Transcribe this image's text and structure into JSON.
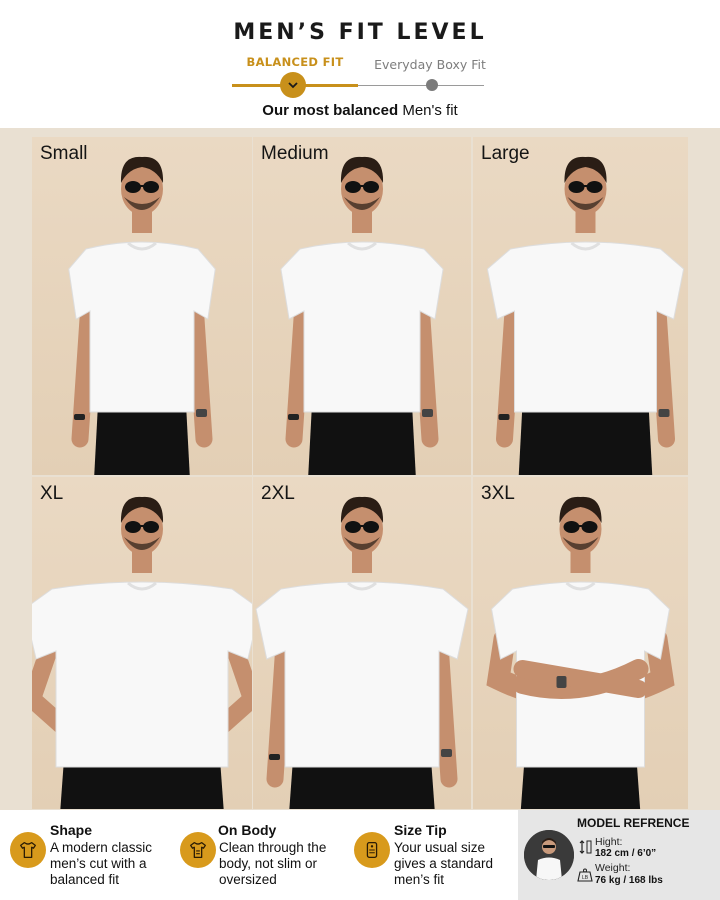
{
  "header": {
    "title": "MEN’S FIT LEVEL",
    "fit_selected": "BALANCED FIT",
    "fit_other": "Everyday Boxy Fit",
    "fit_level": 0.5,
    "subtitle_bold": "Our most balanced",
    "subtitle_rest": "Men's fit"
  },
  "sizes": [
    "Small",
    "Medium",
    "Large",
    "XL",
    "2XL",
    "3XL"
  ],
  "features": [
    {
      "icon": "tshirt-shape-icon",
      "title": "Shape",
      "lines": [
        "A modern classic",
        "men’s cut with a",
        "balanced fit"
      ]
    },
    {
      "icon": "tshirt-body-icon",
      "title": "On Body",
      "lines": [
        "Clean through the",
        "body, not slim or",
        "oversized"
      ]
    },
    {
      "icon": "size-tag-icon",
      "title": "Size Tip",
      "lines": [
        "Your usual size",
        "gives a standard",
        "men’s fit"
      ]
    }
  ],
  "model": {
    "title": "MODEL REFRENCE",
    "height_label": "Hight:",
    "height_value": "182 cm / 6’0”",
    "weight_label": "Weight:",
    "weight_value": "76 kg / 168 lbs"
  },
  "colors": {
    "accent": "#c8901b",
    "icon_bg": "#d89a1c",
    "photo_bg": "#e3cfb5"
  }
}
